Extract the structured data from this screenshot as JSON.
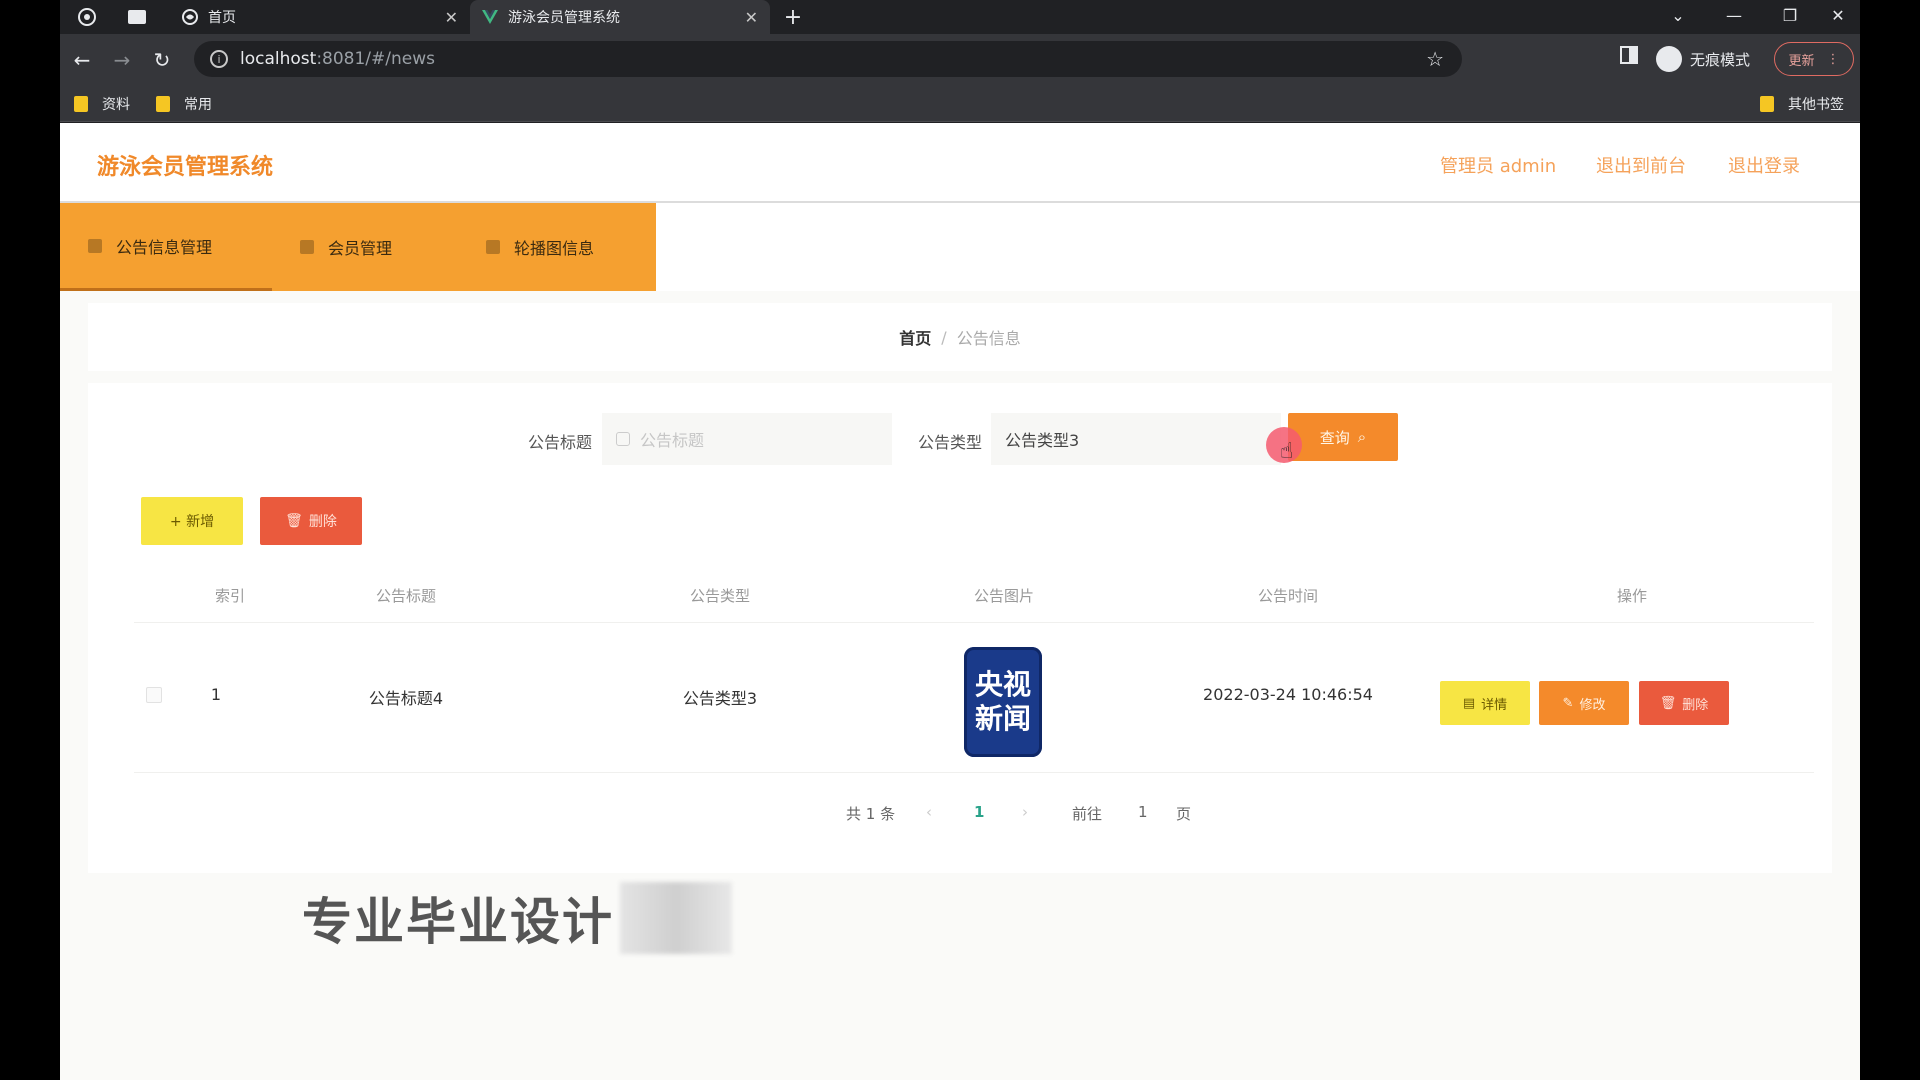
{
  "browser": {
    "tabs": [
      {
        "label": "首页",
        "active": false
      },
      {
        "label": "游泳会员管理系统",
        "active": true
      }
    ],
    "url_host": "localhost",
    "url_rest": ":8081/#/news",
    "incognito_label": "无痕模式",
    "update_label": "更新",
    "bookmarks": [
      "资料",
      "常用"
    ],
    "other_bookmarks": "其他书签"
  },
  "app": {
    "title": "游泳会员管理系统",
    "header_links": [
      "管理员 admin",
      "退出到前台",
      "退出登录"
    ],
    "nav": [
      "公告信息管理",
      "会员管理",
      "轮播图信息"
    ]
  },
  "breadcrumb": {
    "home": "首页",
    "separator": "/",
    "current": "公告信息"
  },
  "search": {
    "title_label": "公告标题",
    "title_placeholder": "公告标题",
    "type_label": "公告类型",
    "type_value": "公告类型3",
    "query_label": "查询"
  },
  "actions": {
    "add_label": "+ 新增",
    "delete_label": "删除"
  },
  "table": {
    "headers": [
      "索引",
      "公告标题",
      "公告类型",
      "公告图片",
      "公告时间",
      "操作"
    ],
    "rows": [
      {
        "index": "1",
        "title": "公告标题4",
        "type": "公告类型3",
        "image_text_line1": "央视",
        "image_text_line2": "新闻",
        "time": "2022-03-24 10:46:54",
        "ops": [
          "详情",
          "修改",
          "删除"
        ]
      }
    ]
  },
  "pagination": {
    "total": "共 1 条",
    "current_page": "1",
    "goto_label": "前往",
    "goto_value": "1",
    "page_suffix": "页"
  },
  "watermark": "专业毕业设计",
  "colors": {
    "brand_orange": "#f5a030",
    "title_orange": "#f0892a",
    "yellow_btn": "#f7e544",
    "red_btn": "#ea5a3d",
    "query_btn": "#f48a2b"
  }
}
